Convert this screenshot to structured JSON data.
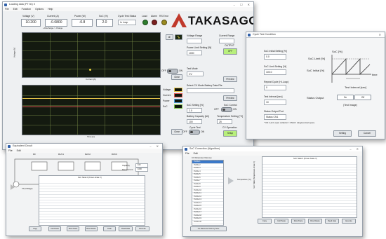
{
  "main_window": {
    "title": "Loading data (PT 30) II",
    "menu": [
      "File",
      "Edit",
      "Function",
      "Options",
      "Help"
    ],
    "readouts": [
      {
        "label": "Voltage (V)",
        "value": "10.200"
      },
      {
        "label": "Current (A)",
        "value": "-0.0800"
      },
      {
        "label": "Power (W)",
        "value": "-0.8"
      },
      {
        "label": "SoC (%)",
        "value": "2.0"
      }
    ],
    "current_sub": "+:Discharge / -:Charge",
    "cycle_test_status_label": "Cycle Test Status",
    "cycle_test_status_value": "In Loop",
    "indicators": [
      "Load",
      "Alarm",
      "RS Error"
    ],
    "brand": "TAKASAGO",
    "chart1_ylabel": "Voltage [V]",
    "chart1_xlabel": "Current [A]",
    "chart2_xlabel": "Time [s]",
    "chart2_legend": [
      "Voltage",
      "Current",
      "Power",
      "SoC"
    ],
    "clear_label": "Clear",
    "reset_off": "OFF",
    "reset_on": "ON",
    "right_panel": {
      "voltage_range_label": "Voltage Range",
      "current_range_label": "Current Range",
      "power_limit_label": "Power Limit Setting [W]",
      "power_limit_value": "1000",
      "output_label": "OUTPUT",
      "output_button": "OFF",
      "test_mode_label": "Test Mode",
      "test_mode_value": "CV",
      "preview_label": "Preview",
      "select_file_label": "Select CV Mode Battery Data File",
      "soc_setting_label": "SoC Setting [%]",
      "soc_setting_value": "2.0",
      "soc_control_label": "SoC Control",
      "soc_off": "OFF",
      "soc_on": "ON",
      "battery_capacity_label": "Battery Capacity [Ah]",
      "battery_capacity_value": "100",
      "temperature_label": "Temperature Setting [°C]",
      "temperature_value": "25",
      "cycle_test_label": "Cycle Test",
      "cv_operation_label": "CV Operation",
      "cycle_off": "OFF",
      "cycle_on": "ON",
      "setup_button": "Setup"
    }
  },
  "cycle_dialog": {
    "title": "Cycle Test Condition",
    "fields": [
      {
        "label": "SoC Initial Setting [%]",
        "value": "0.0"
      },
      {
        "label": "SoC Limit Setting [%]",
        "value": "100.0"
      },
      {
        "label": "Repeat Cycle (Hi-Loop)",
        "value": "0"
      },
      {
        "label": "Test Interval [sec]",
        "value": "10"
      },
      {
        "label": "Status Output Port",
        "value": "Status CN1"
      }
    ],
    "note": "* CN 1,2,3: open collector / CN4,5: relay(normal open)",
    "diagram_soc": "SoC [%]",
    "diagram_limit": "SoC Limit [%]",
    "diagram_initial": "SoC Initial [%]",
    "diagram_time": "time",
    "diagram_interval": "Test Interval [sec]",
    "status_output_label": "Status Output",
    "status_on": "On",
    "status_off": "Off",
    "test_image": "(Test Image)",
    "setting_button": "Setting",
    "cancel_button": "Cancel"
  },
  "circuit_window": {
    "title": "Equivalent Circuit",
    "menu": [
      "File",
      "Edit"
    ],
    "node_labels": [
      "R0",
      "R1/C1",
      "R2/C2",
      "R3/C3"
    ],
    "table_title": "SoC Table 0 (Power-Scale V)",
    "param_labels": [
      "Capacity",
      "Max Current"
    ],
    "param_values": [
      "100",
      "1000"
    ],
    "buttons": [
      "Copy",
      "Cell Paste",
      "Row Paste",
      "Row Delete",
      "Clear",
      "Read data",
      "Execute"
    ],
    "source_label": "V0 (Voltage)"
  },
  "param_window": {
    "title": "SoC Correction (Algorithm)",
    "menu": [
      "File",
      "Edit"
    ],
    "list_header": "CV Parameter Memory",
    "list_items": [
      "Profile 1",
      "Profile 2",
      "Profile 3",
      "Profile 4",
      "Profile 5",
      "Profile 6",
      "Profile 7",
      "Profile 8",
      "Profile 9",
      "Profile 10",
      "Profile 11",
      "Profile 12",
      "Profile 13",
      "Profile 14",
      "Profile 15",
      "Profile 16",
      "Profile 17",
      "Profile 18",
      "Profile 19",
      "Profile 20"
    ],
    "side_label": "Temperature [°C]",
    "table_title": "SoC Table 0 (Power-Scale V)",
    "table_subtitle": "SoC Table (Temperature-Scale V)",
    "buttons": [
      "Copy",
      "Cell Paste",
      "Row Paste",
      "Row Delete",
      "Read data",
      "Execute"
    ],
    "list_button": "CV Parameter Memory Save"
  }
}
